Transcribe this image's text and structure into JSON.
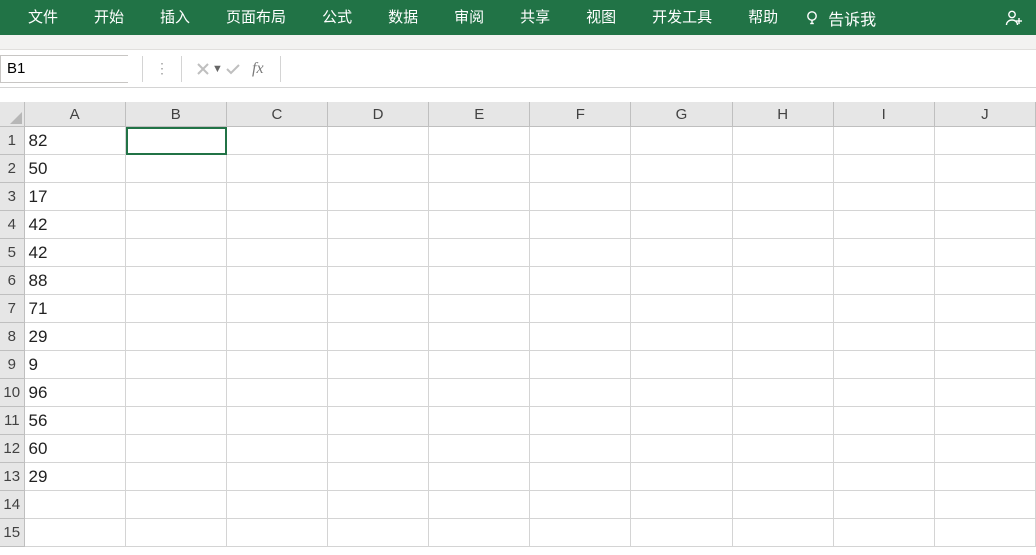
{
  "ribbon": {
    "tabs": [
      "文件",
      "开始",
      "插入",
      "页面布局",
      "公式",
      "数据",
      "审阅",
      "共享",
      "视图",
      "开发工具",
      "帮助"
    ],
    "tell_me": "告诉我"
  },
  "formula_bar": {
    "name_box": "B1",
    "fx_label": "fx",
    "formula_value": ""
  },
  "grid": {
    "columns": [
      "A",
      "B",
      "C",
      "D",
      "E",
      "F",
      "G",
      "H",
      "I",
      "J"
    ],
    "row_count": 15,
    "selected_cell": "B1",
    "cells": {
      "A1": "82",
      "A2": "50",
      "A3": "17",
      "A4": "42",
      "A5": "42",
      "A6": "88",
      "A7": "71",
      "A8": "29",
      "A9": "9",
      "A10": "96",
      "A11": "56",
      "A12": "60",
      "A13": "29"
    }
  }
}
